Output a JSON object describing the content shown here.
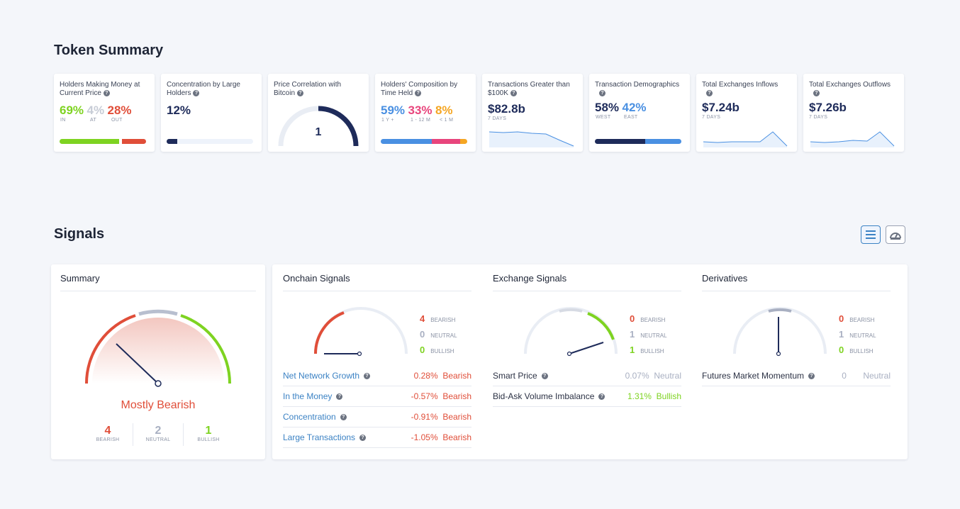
{
  "token_summary": {
    "title": "Token Summary",
    "cards": {
      "money": {
        "title": "Holders Making Money at Current Price",
        "in": "69%",
        "at": "4%",
        "out": "28%",
        "in_label": "IN",
        "at_label": "AT",
        "out_label": "OUT",
        "in_share": 0.69,
        "out_share": 0.28
      },
      "concentration": {
        "title": "Concentration by Large Holders",
        "value": "12%",
        "share": 0.12
      },
      "correlation": {
        "title": "Price Correlation with Bitcoin",
        "value": "1"
      },
      "composition": {
        "title": "Holders' Composition by Time Held",
        "long": "59%",
        "mid": "33%",
        "short": "8%",
        "long_label": "1 Y +",
        "mid_label": "1 - 12 M",
        "short_label": "< 1 M",
        "long_share": 0.59,
        "mid_share": 0.33,
        "short_share": 0.08
      },
      "large_tx": {
        "title": "Transactions Greater than $100K",
        "value": "$82.8b",
        "period": "7 DAYS"
      },
      "demographics": {
        "title": "Transaction Demographics",
        "west": "58%",
        "east": "42%",
        "west_label": "WEST",
        "east_label": "EAST",
        "west_share": 0.58
      },
      "inflows": {
        "title": "Total Exchanges Inflows",
        "value": "$7.24b",
        "period": "7 DAYS"
      },
      "outflows": {
        "title": "Total Exchanges Outflows",
        "value": "$7.26b",
        "period": "7 DAYS"
      }
    }
  },
  "signals": {
    "title": "Signals",
    "view_icons": [
      "list-view-icon",
      "gauge-view-icon"
    ],
    "summary": {
      "title": "Summary",
      "verdict": "Mostly Bearish",
      "bearish": "4",
      "neutral": "2",
      "bullish": "1",
      "bearish_label": "BEARISH",
      "neutral_label": "NEUTRAL",
      "bullish_label": "BULLISH"
    },
    "onchain": {
      "title": "Onchain Signals",
      "bearish": "4",
      "neutral": "0",
      "bullish": "0",
      "rows": [
        {
          "name": "Net Network Growth",
          "value": "0.28%",
          "signal": "Bearish"
        },
        {
          "name": "In the Money",
          "value": "-0.57%",
          "signal": "Bearish"
        },
        {
          "name": "Concentration",
          "value": "-0.91%",
          "signal": "Bearish"
        },
        {
          "name": "Large Transactions",
          "value": "-1.05%",
          "signal": "Bearish"
        }
      ]
    },
    "exchange": {
      "title": "Exchange Signals",
      "bearish": "0",
      "neutral": "1",
      "bullish": "1",
      "rows": [
        {
          "name": "Smart Price",
          "value": "0.07%",
          "signal": "Neutral"
        },
        {
          "name": "Bid-Ask Volume Imbalance",
          "value": "1.31%",
          "signal": "Bullish"
        }
      ]
    },
    "derivatives": {
      "title": "Derivatives",
      "bearish": "0",
      "neutral": "1",
      "bullish": "0",
      "rows": [
        {
          "name": "Futures Market Momentum",
          "value": "0",
          "signal": "Neutral"
        }
      ]
    },
    "count_labels": {
      "bearish": "BEARISH",
      "neutral": "NEUTRAL",
      "bullish": "BULLISH"
    }
  },
  "colors": {
    "bearish": "#e04e39",
    "neutral": "#a9b0c2",
    "bullish": "#7ed321",
    "navy": "#1e2b5a",
    "link": "#3b82c4"
  }
}
